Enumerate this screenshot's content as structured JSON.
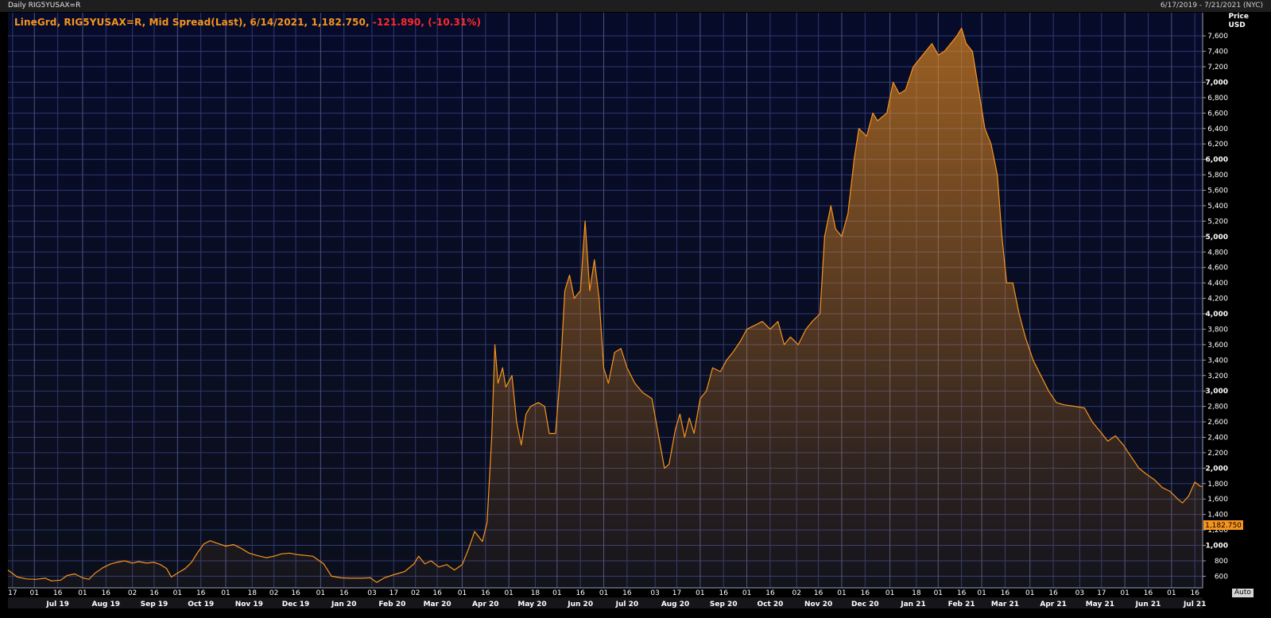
{
  "header": {
    "left_title": "Daily RIG5YUSAX=R",
    "date_range": "6/17/2019 - 7/21/2021 (NYC)"
  },
  "legend": {
    "main_text": "LineGrd, RIG5YUSAX=R, Mid Spread(Last), 6/14/2021, 1,182.750,",
    "change_text": " -121.890, (-10.31%)"
  },
  "yaxis": {
    "label_line1": "Price",
    "label_line2": "USD",
    "auto_label": "Auto"
  },
  "last_value_tag": "1,182.750",
  "colors": {
    "background": "#060b24",
    "grid": "#2f3a70",
    "line": "#f7941d",
    "down": "#ff2a2a",
    "tag": "#f7941d"
  },
  "chart_data": {
    "type": "area",
    "title": "LineGrd, RIG5YUSAX=R, Mid Spread(Last)",
    "ylabel": "Price USD",
    "ylim": [
      450,
      7900
    ],
    "xlim": [
      "2019-06-14",
      "2021-07-21"
    ],
    "grid": true,
    "y_ticks": [
      600,
      800,
      1000,
      1200,
      1400,
      1600,
      1800,
      2000,
      2200,
      2400,
      2600,
      2800,
      3000,
      3200,
      3400,
      3600,
      3800,
      4000,
      4200,
      4400,
      4600,
      4800,
      5000,
      5200,
      5400,
      5600,
      5800,
      6000,
      6200,
      6400,
      6600,
      6800,
      7000,
      7200,
      7400,
      7600
    ],
    "y_tick_labels": [
      "600",
      "800",
      "1,000",
      "1,200",
      "1,400",
      "1,600",
      "1,800",
      "2,000",
      "2,200",
      "2,400",
      "2,600",
      "2,800",
      "3,000",
      "3,200",
      "3,400",
      "3,600",
      "3,800",
      "4,000",
      "4,200",
      "4,400",
      "4,600",
      "4,800",
      "5,000",
      "5,200",
      "5,400",
      "5,600",
      "5,800",
      "6,000",
      "6,200",
      "6,400",
      "6,600",
      "6,800",
      "7,000",
      "7,200",
      "7,400",
      "7,600"
    ],
    "x_ticks_day": [
      {
        "date": "2019-06-17",
        "label": "17"
      },
      {
        "date": "2019-07-01",
        "label": "01"
      },
      {
        "date": "2019-07-16",
        "label": "16"
      },
      {
        "date": "2019-08-01",
        "label": "01"
      },
      {
        "date": "2019-08-16",
        "label": "16"
      },
      {
        "date": "2019-09-02",
        "label": "02"
      },
      {
        "date": "2019-09-16",
        "label": "16"
      },
      {
        "date": "2019-10-01",
        "label": "01"
      },
      {
        "date": "2019-10-16",
        "label": "16"
      },
      {
        "date": "2019-11-01",
        "label": "01"
      },
      {
        "date": "2019-11-18",
        "label": "18"
      },
      {
        "date": "2019-12-02",
        "label": "02"
      },
      {
        "date": "2019-12-16",
        "label": "16"
      },
      {
        "date": "2020-01-01",
        "label": "01"
      },
      {
        "date": "2020-01-16",
        "label": "16"
      },
      {
        "date": "2020-02-03",
        "label": "03"
      },
      {
        "date": "2020-02-17",
        "label": "17"
      },
      {
        "date": "2020-03-02",
        "label": "02"
      },
      {
        "date": "2020-03-16",
        "label": "16"
      },
      {
        "date": "2020-04-01",
        "label": "01"
      },
      {
        "date": "2020-04-16",
        "label": "16"
      },
      {
        "date": "2020-05-01",
        "label": "01"
      },
      {
        "date": "2020-05-18",
        "label": "18"
      },
      {
        "date": "2020-06-01",
        "label": "01"
      },
      {
        "date": "2020-06-16",
        "label": "16"
      },
      {
        "date": "2020-07-01",
        "label": "01"
      },
      {
        "date": "2020-07-16",
        "label": "16"
      },
      {
        "date": "2020-08-03",
        "label": "03"
      },
      {
        "date": "2020-08-17",
        "label": "17"
      },
      {
        "date": "2020-09-01",
        "label": "01"
      },
      {
        "date": "2020-09-16",
        "label": "16"
      },
      {
        "date": "2020-10-01",
        "label": "01"
      },
      {
        "date": "2020-10-16",
        "label": "16"
      },
      {
        "date": "2020-11-02",
        "label": "02"
      },
      {
        "date": "2020-11-16",
        "label": "16"
      },
      {
        "date": "2020-12-01",
        "label": "01"
      },
      {
        "date": "2020-12-16",
        "label": "16"
      },
      {
        "date": "2021-01-01",
        "label": "01"
      },
      {
        "date": "2021-01-18",
        "label": "18"
      },
      {
        "date": "2021-02-01",
        "label": "01"
      },
      {
        "date": "2021-02-16",
        "label": "16"
      },
      {
        "date": "2021-03-01",
        "label": "01"
      },
      {
        "date": "2021-03-16",
        "label": "16"
      },
      {
        "date": "2021-04-01",
        "label": "01"
      },
      {
        "date": "2021-04-16",
        "label": "16"
      },
      {
        "date": "2021-05-03",
        "label": "03"
      },
      {
        "date": "2021-05-17",
        "label": "17"
      },
      {
        "date": "2021-06-01",
        "label": "01"
      },
      {
        "date": "2021-06-16",
        "label": "16"
      },
      {
        "date": "2021-07-01",
        "label": "01"
      },
      {
        "date": "2021-07-16",
        "label": "16"
      }
    ],
    "x_ticks_month": [
      {
        "date": "2019-07-16",
        "label": "Jul 19"
      },
      {
        "date": "2019-08-16",
        "label": "Aug 19"
      },
      {
        "date": "2019-09-16",
        "label": "Sep 19"
      },
      {
        "date": "2019-10-16",
        "label": "Oct 19"
      },
      {
        "date": "2019-11-16",
        "label": "Nov 19"
      },
      {
        "date": "2019-12-16",
        "label": "Dec 19"
      },
      {
        "date": "2020-01-16",
        "label": "Jan 20"
      },
      {
        "date": "2020-02-16",
        "label": "Feb 20"
      },
      {
        "date": "2020-03-16",
        "label": "Mar 20"
      },
      {
        "date": "2020-04-16",
        "label": "Apr 20"
      },
      {
        "date": "2020-05-16",
        "label": "May 20"
      },
      {
        "date": "2020-06-16",
        "label": "Jun 20"
      },
      {
        "date": "2020-07-16",
        "label": "Jul 20"
      },
      {
        "date": "2020-08-16",
        "label": "Aug 20"
      },
      {
        "date": "2020-09-16",
        "label": "Sep 20"
      },
      {
        "date": "2020-10-16",
        "label": "Oct 20"
      },
      {
        "date": "2020-11-16",
        "label": "Nov 20"
      },
      {
        "date": "2020-12-16",
        "label": "Dec 20"
      },
      {
        "date": "2021-01-16",
        "label": "Jan 21"
      },
      {
        "date": "2021-02-16",
        "label": "Feb 21"
      },
      {
        "date": "2021-03-16",
        "label": "Mar 21"
      },
      {
        "date": "2021-04-16",
        "label": "Apr 21"
      },
      {
        "date": "2021-05-16",
        "label": "May 21"
      },
      {
        "date": "2021-06-16",
        "label": "Jun 21"
      },
      {
        "date": "2021-07-16",
        "label": "Jul 21"
      }
    ],
    "series": [
      {
        "points": [
          [
            "2019-06-14",
            680
          ],
          [
            "2019-06-20",
            590
          ],
          [
            "2019-06-26",
            565
          ],
          [
            "2019-07-02",
            560
          ],
          [
            "2019-07-08",
            575
          ],
          [
            "2019-07-12",
            540
          ],
          [
            "2019-07-18",
            550
          ],
          [
            "2019-07-22",
            610
          ],
          [
            "2019-07-27",
            630
          ],
          [
            "2019-08-01",
            580
          ],
          [
            "2019-08-05",
            560
          ],
          [
            "2019-08-09",
            640
          ],
          [
            "2019-08-14",
            710
          ],
          [
            "2019-08-19",
            760
          ],
          [
            "2019-08-23",
            780
          ],
          [
            "2019-08-28",
            800
          ],
          [
            "2019-09-02",
            770
          ],
          [
            "2019-09-06",
            790
          ],
          [
            "2019-09-11",
            770
          ],
          [
            "2019-09-16",
            780
          ],
          [
            "2019-09-20",
            750
          ],
          [
            "2019-09-24",
            700
          ],
          [
            "2019-09-27",
            590
          ],
          [
            "2019-10-01",
            640
          ],
          [
            "2019-10-06",
            700
          ],
          [
            "2019-10-10",
            780
          ],
          [
            "2019-10-14",
            910
          ],
          [
            "2019-10-18",
            1020
          ],
          [
            "2019-10-22",
            1060
          ],
          [
            "2019-10-26",
            1030
          ],
          [
            "2019-11-01",
            990
          ],
          [
            "2019-11-06",
            1010
          ],
          [
            "2019-11-11",
            960
          ],
          [
            "2019-11-16",
            900
          ],
          [
            "2019-11-21",
            870
          ],
          [
            "2019-11-27",
            840
          ],
          [
            "2019-12-02",
            860
          ],
          [
            "2019-12-07",
            890
          ],
          [
            "2019-12-12",
            900
          ],
          [
            "2019-12-17",
            880
          ],
          [
            "2019-12-22",
            870
          ],
          [
            "2019-12-27",
            860
          ],
          [
            "2020-01-03",
            760
          ],
          [
            "2020-01-08",
            600
          ],
          [
            "2020-01-14",
            580
          ],
          [
            "2020-01-20",
            575
          ],
          [
            "2020-01-27",
            575
          ],
          [
            "2020-02-02",
            580
          ],
          [
            "2020-02-06",
            520
          ],
          [
            "2020-02-11",
            580
          ],
          [
            "2020-02-17",
            620
          ],
          [
            "2020-02-24",
            660
          ],
          [
            "2020-03-01",
            760
          ],
          [
            "2020-03-04",
            860
          ],
          [
            "2020-03-08",
            760
          ],
          [
            "2020-03-12",
            800
          ],
          [
            "2020-03-17",
            720
          ],
          [
            "2020-03-22",
            750
          ],
          [
            "2020-03-27",
            680
          ],
          [
            "2020-04-01",
            750
          ],
          [
            "2020-04-05",
            950
          ],
          [
            "2020-04-09",
            1180
          ],
          [
            "2020-04-14",
            1050
          ],
          [
            "2020-04-17",
            1300
          ],
          [
            "2020-04-20",
            2400
          ],
          [
            "2020-04-22",
            3600
          ],
          [
            "2020-04-24",
            3100
          ],
          [
            "2020-04-27",
            3300
          ],
          [
            "2020-04-29",
            3050
          ],
          [
            "2020-05-03",
            3200
          ],
          [
            "2020-05-06",
            2600
          ],
          [
            "2020-05-09",
            2300
          ],
          [
            "2020-05-12",
            2700
          ],
          [
            "2020-05-15",
            2800
          ],
          [
            "2020-05-20",
            2850
          ],
          [
            "2020-05-24",
            2800
          ],
          [
            "2020-05-27",
            2450
          ],
          [
            "2020-05-31",
            2450
          ],
          [
            "2020-06-03",
            3200
          ],
          [
            "2020-06-06",
            4300
          ],
          [
            "2020-06-09",
            4500
          ],
          [
            "2020-06-12",
            4200
          ],
          [
            "2020-06-16",
            4300
          ],
          [
            "2020-06-19",
            5200
          ],
          [
            "2020-06-22",
            4300
          ],
          [
            "2020-06-25",
            4700
          ],
          [
            "2020-06-28",
            4200
          ],
          [
            "2020-07-01",
            3300
          ],
          [
            "2020-07-04",
            3100
          ],
          [
            "2020-07-08",
            3500
          ],
          [
            "2020-07-12",
            3550
          ],
          [
            "2020-07-16",
            3300
          ],
          [
            "2020-07-21",
            3100
          ],
          [
            "2020-07-26",
            2980
          ],
          [
            "2020-08-01",
            2900
          ],
          [
            "2020-08-05",
            2450
          ],
          [
            "2020-08-09",
            2000
          ],
          [
            "2020-08-12",
            2050
          ],
          [
            "2020-08-16",
            2500
          ],
          [
            "2020-08-19",
            2700
          ],
          [
            "2020-08-22",
            2400
          ],
          [
            "2020-08-25",
            2650
          ],
          [
            "2020-08-28",
            2450
          ],
          [
            "2020-09-01",
            2900
          ],
          [
            "2020-09-05",
            3000
          ],
          [
            "2020-09-09",
            3300
          ],
          [
            "2020-09-14",
            3250
          ],
          [
            "2020-09-18",
            3400
          ],
          [
            "2020-09-22",
            3500
          ],
          [
            "2020-09-27",
            3650
          ],
          [
            "2020-10-01",
            3800
          ],
          [
            "2020-10-06",
            3850
          ],
          [
            "2020-10-11",
            3900
          ],
          [
            "2020-10-16",
            3800
          ],
          [
            "2020-10-21",
            3900
          ],
          [
            "2020-10-25",
            3600
          ],
          [
            "2020-10-29",
            3700
          ],
          [
            "2020-11-03",
            3600
          ],
          [
            "2020-11-08",
            3800
          ],
          [
            "2020-11-12",
            3900
          ],
          [
            "2020-11-17",
            4000
          ],
          [
            "2020-11-20",
            5000
          ],
          [
            "2020-11-24",
            5400
          ],
          [
            "2020-11-27",
            5100
          ],
          [
            "2020-12-01",
            5000
          ],
          [
            "2020-12-05",
            5300
          ],
          [
            "2020-12-09",
            6000
          ],
          [
            "2020-12-12",
            6400
          ],
          [
            "2020-12-17",
            6300
          ],
          [
            "2020-12-21",
            6600
          ],
          [
            "2020-12-24",
            6500
          ],
          [
            "2020-12-30",
            6600
          ],
          [
            "2021-01-03",
            7000
          ],
          [
            "2021-01-07",
            6850
          ],
          [
            "2021-01-11",
            6900
          ],
          [
            "2021-01-16",
            7200
          ],
          [
            "2021-01-20",
            7300
          ],
          [
            "2021-01-24",
            7400
          ],
          [
            "2021-01-28",
            7500
          ],
          [
            "2021-02-01",
            7350
          ],
          [
            "2021-02-05",
            7400
          ],
          [
            "2021-02-09",
            7500
          ],
          [
            "2021-02-13",
            7600
          ],
          [
            "2021-02-16",
            7700
          ],
          [
            "2021-02-19",
            7500
          ],
          [
            "2021-02-23",
            7400
          ],
          [
            "2021-02-27",
            6900
          ],
          [
            "2021-03-03",
            6400
          ],
          [
            "2021-03-07",
            6200
          ],
          [
            "2021-03-11",
            5800
          ],
          [
            "2021-03-14",
            5000
          ],
          [
            "2021-03-17",
            4400
          ],
          [
            "2021-03-21",
            4400
          ],
          [
            "2021-03-25",
            4000
          ],
          [
            "2021-03-29",
            3700
          ],
          [
            "2021-04-03",
            3400
          ],
          [
            "2021-04-08",
            3200
          ],
          [
            "2021-04-13",
            3000
          ],
          [
            "2021-04-18",
            2850
          ],
          [
            "2021-04-23",
            2820
          ],
          [
            "2021-04-30",
            2800
          ],
          [
            "2021-05-06",
            2780
          ],
          [
            "2021-05-11",
            2600
          ],
          [
            "2021-05-16",
            2480
          ],
          [
            "2021-05-21",
            2350
          ],
          [
            "2021-05-26",
            2420
          ],
          [
            "2021-05-31",
            2300
          ],
          [
            "2021-06-05",
            2150
          ],
          [
            "2021-06-10",
            2000
          ],
          [
            "2021-06-15",
            1920
          ],
          [
            "2021-06-20",
            1850
          ],
          [
            "2021-06-25",
            1750
          ],
          [
            "2021-06-30",
            1700
          ],
          [
            "2021-07-05",
            1600
          ],
          [
            "2021-07-08",
            1550
          ],
          [
            "2021-07-12",
            1640
          ],
          [
            "2021-07-16",
            1820
          ],
          [
            "2021-07-19",
            1770
          ],
          [
            "2021-07-21",
            1760
          ]
        ]
      }
    ]
  }
}
